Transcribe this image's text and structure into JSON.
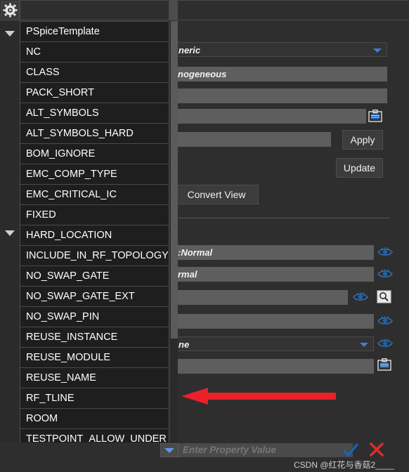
{
  "app": {
    "theme_bg": "#2e2e2e",
    "accent_blue": "#1565c0",
    "accent_red": "#d32f2f",
    "arrow_color": "#e8212b"
  },
  "left_column": {
    "gear_icon": "gear-icon",
    "collapse_icon_top": "collapse-triangle-icon",
    "collapse_icon_mid": "collapse-triangle-icon"
  },
  "property_dropdown": {
    "name": "property-name-dropdown-list",
    "items": [
      {
        "label": "PSpiceTemplate"
      },
      {
        "label": "NC"
      },
      {
        "label": "CLASS"
      },
      {
        "label": "PACK_SHORT"
      },
      {
        "label": "ALT_SYMBOLS"
      },
      {
        "label": "ALT_SYMBOLS_HARD"
      },
      {
        "label": "BOM_IGNORE"
      },
      {
        "label": "EMC_COMP_TYPE"
      },
      {
        "label": "EMC_CRITICAL_IC"
      },
      {
        "label": "FIXED"
      },
      {
        "label": "HARD_LOCATION"
      },
      {
        "label": "INCLUDE_IN_RF_TOPOLOGY"
      },
      {
        "label": "NO_SWAP_GATE"
      },
      {
        "label": "NO_SWAP_GATE_EXT"
      },
      {
        "label": "NO_SWAP_PIN"
      },
      {
        "label": "REUSE_INSTANCE"
      },
      {
        "label": "REUSE_MODULE"
      },
      {
        "label": "REUSE_NAME"
      },
      {
        "label": "RF_TLINE"
      },
      {
        "label": "ROOM"
      },
      {
        "label": "TESTPOINT_ALLOW_UNDER"
      }
    ]
  },
  "properties_panel": {
    "fields": [
      {
        "name": "type-combo",
        "value": "neric",
        "kind": "combo"
      },
      {
        "name": "homogeneous-field",
        "value": "nogeneous",
        "kind": "text"
      },
      {
        "name": "blank-field-1",
        "value": "",
        "kind": "text"
      },
      {
        "name": "clipboard-field-1",
        "value": "",
        "kind": "text"
      },
      {
        "name": "apply-field",
        "value": "",
        "kind": "text"
      },
      {
        "name": "normal-field-1",
        "value": ":Normal",
        "kind": "text"
      },
      {
        "name": "normal-field-2",
        "value": "rmal",
        "kind": "text"
      },
      {
        "name": "search-field",
        "value": "",
        "kind": "text"
      },
      {
        "name": "blank-field-2",
        "value": "",
        "kind": "text"
      },
      {
        "name": "none-combo",
        "value": "ne",
        "kind": "combo"
      },
      {
        "name": "clipboard-field-2",
        "value": "",
        "kind": "text"
      }
    ],
    "buttons": {
      "apply": "Apply",
      "update": "Update",
      "convert_view": "Convert View"
    },
    "icons": {
      "eye": "eye-visibility-icon",
      "clipboard": "clipboard-icon",
      "magnifier": "magnifier-browse-icon",
      "caret": "chevron-down-icon"
    }
  },
  "bottom_bar": {
    "value_input_placeholder": "Enter Property Value",
    "confirm_icon": "checkmark-icon",
    "cancel_icon": "cancel-x-icon",
    "combo_icon": "chevron-down-icon"
  },
  "watermark": {
    "text": "CSDN @红花与香菇2____"
  },
  "annotation": {
    "arrow": "red-left-arrow-annotation"
  }
}
